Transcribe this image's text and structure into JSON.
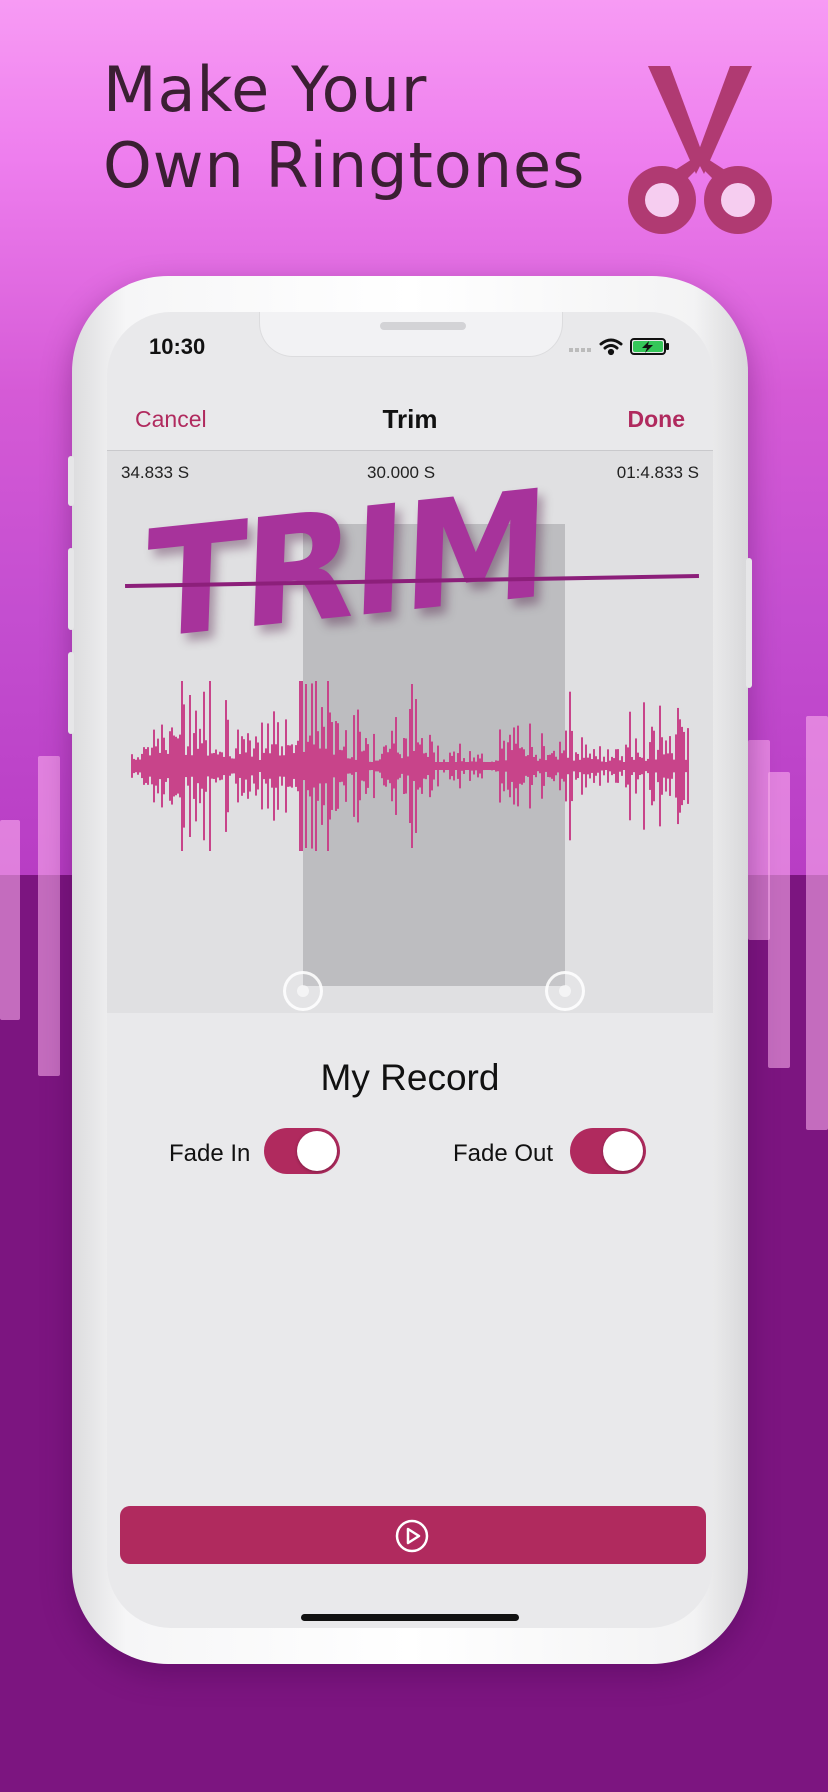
{
  "promo": {
    "headline_line1": "Make Your",
    "headline_line2": "Own Ringtones",
    "icon": "scissors-icon"
  },
  "status_bar": {
    "time": "10:30",
    "icons": [
      "signal-icon",
      "wifi-icon",
      "battery-charging-icon"
    ]
  },
  "nav": {
    "cancel_label": "Cancel",
    "title": "Trim",
    "done_label": "Done"
  },
  "timeline": {
    "start_label": "34.833 S",
    "duration_label": "30.000 S",
    "end_label": "01:4.833 S"
  },
  "overlay_text": "TRIM",
  "record": {
    "name": "My Record"
  },
  "toggles": {
    "fade_in_label": "Fade In",
    "fade_in_on": true,
    "fade_out_label": "Fade Out",
    "fade_out_on": true
  },
  "play_button": {
    "icon": "play-circle-icon"
  },
  "colors": {
    "accent": "#b02a5e",
    "waveform": "#c8448a",
    "background_top": "#e070e4",
    "background_bottom": "#7c1580"
  }
}
